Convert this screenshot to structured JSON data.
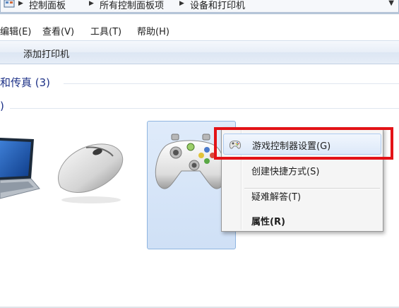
{
  "addressbar": {
    "crumbs": [
      "控制面板",
      "所有控制面板项",
      "设备和打印机"
    ]
  },
  "menubar": {
    "edit": "编辑(E)",
    "view": "查看(V)",
    "tools": "工具(T)",
    "help": "帮助(H)"
  },
  "toolbar": {
    "add_printer": "添加打印机"
  },
  "groups": {
    "printers_title": "和传真 (3)",
    "devices_title": ")"
  },
  "context_menu": {
    "items": [
      {
        "label": "游戏控制器设置(G)",
        "icon": "gamepad-icon"
      },
      {
        "label": "创建快捷方式(S)"
      },
      {
        "label": "疑难解答(T)"
      },
      {
        "label": "属性(R)"
      }
    ]
  },
  "colors": {
    "highlight_border": "#e31217",
    "selection_fill": "#cfe0f6",
    "group_title": "#1e3287"
  }
}
